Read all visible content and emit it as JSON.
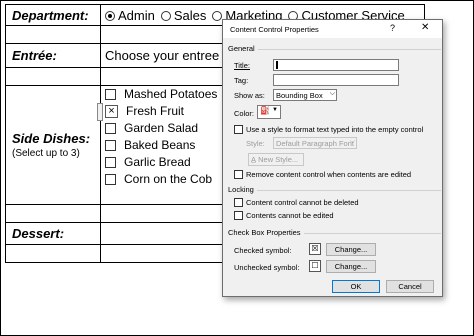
{
  "form": {
    "department_label": "Department:",
    "department_options": [
      {
        "label": "Admin",
        "selected": true
      },
      {
        "label": "Sales",
        "selected": false
      },
      {
        "label": "Marketing",
        "selected": false
      },
      {
        "label": "Customer Service",
        "selected": false
      }
    ],
    "entree_label": "Entrée:",
    "entree_value": "Choose your entree",
    "side_label": "Side Dishes:",
    "side_note": "(Select up to 3)",
    "side_items": [
      {
        "label": "Mashed Potatoes",
        "checked": false
      },
      {
        "label": "Fresh Fruit",
        "checked": true
      },
      {
        "label": "Garden Salad",
        "checked": false
      },
      {
        "label": "Baked Beans",
        "checked": false
      },
      {
        "label": "Garlic Bread",
        "checked": false
      },
      {
        "label": "Corn on the Cob",
        "checked": false
      }
    ],
    "dessert_label": "Dessert:"
  },
  "dialog": {
    "title": "Content Control Properties",
    "help": "?",
    "close": "✕",
    "general": "General",
    "title_label": "Title:",
    "title_value": "",
    "tag_label": "Tag:",
    "tag_value": "",
    "show_as_label": "Show as:",
    "show_as_value": "Bounding Box",
    "color_label": "Color:",
    "use_style_label": "Use a style to format text typed into the empty control",
    "style_label": "Style:",
    "style_value": "Default Paragraph Font",
    "new_style": "New Style...",
    "remove_label": "Remove content control when contents are edited",
    "locking": "Locking",
    "lock_delete": "Content control cannot be deleted",
    "lock_edit": "Contents cannot be edited",
    "checkbox_props": "Check Box Properties",
    "checked_symbol_label": "Checked symbol:",
    "checked_symbol": "☒",
    "unchecked_symbol_label": "Unchecked symbol:",
    "unchecked_symbol": "☐",
    "change_button": "Change...",
    "ok": "OK",
    "cancel": "Cancel"
  }
}
